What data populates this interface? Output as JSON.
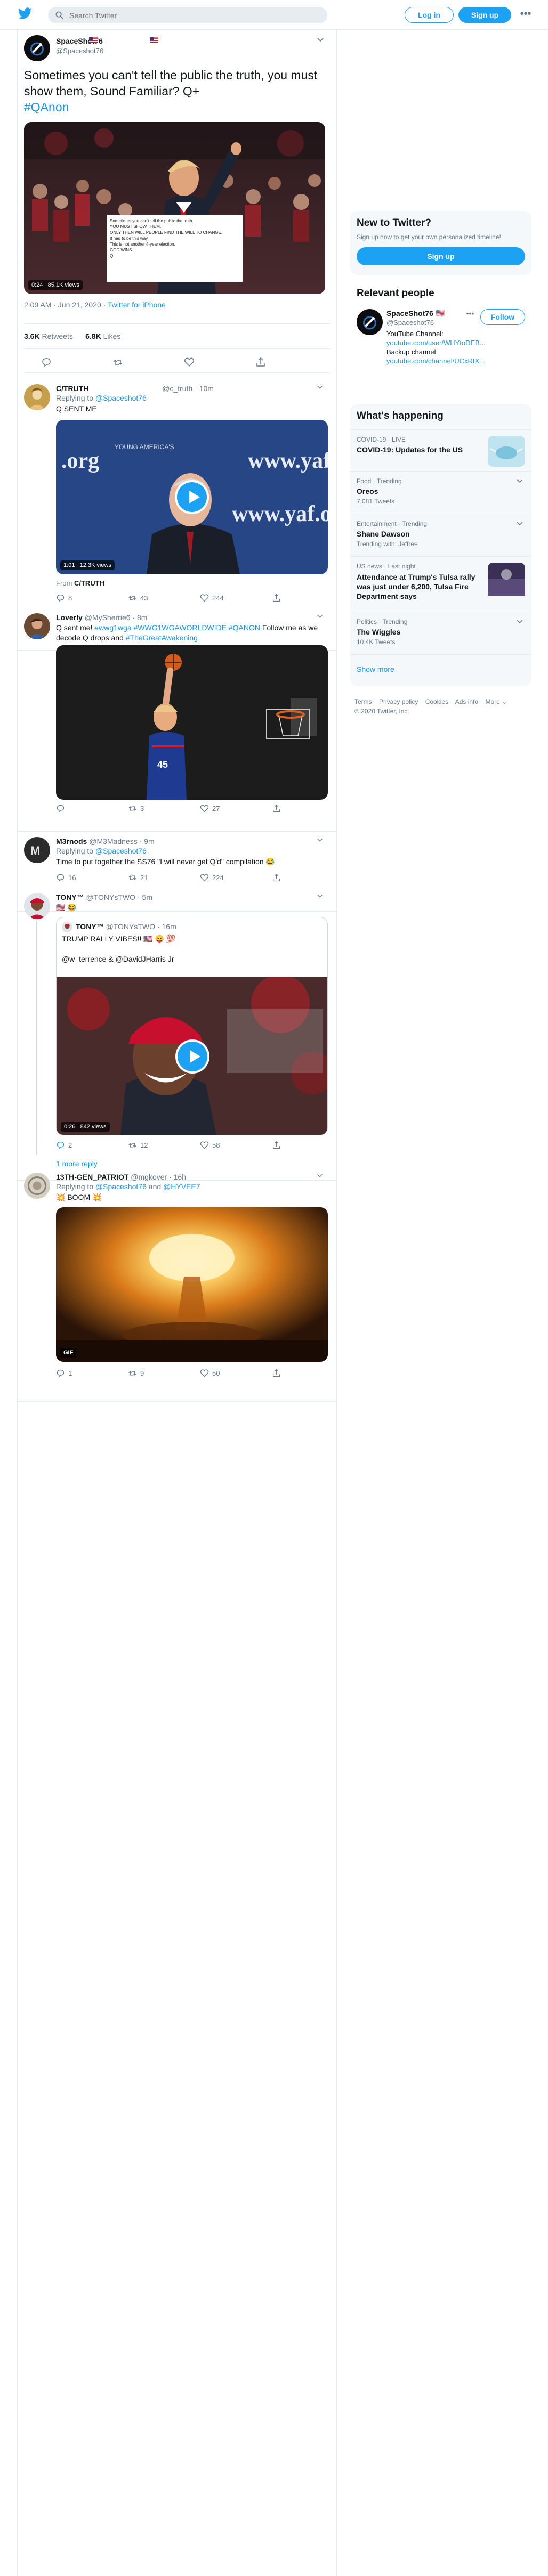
{
  "header": {
    "search_placeholder": "Search Twitter",
    "login_label": "Log in",
    "signup_label": "Sign up",
    "more_icon": "more-dots-icon"
  },
  "focal_tweet": {
    "name": "SpaceShot76",
    "flag": "🇺🇸",
    "handle": "@Spaceshot76",
    "text": "Sometimes you can't tell the public the truth, you must show them, Sound Familiar?  Q+",
    "hashtag": "#QAnon",
    "video_duration": "0:24",
    "video_views": "85.1K views",
    "overlay_lines": [
      "Sometimes you can't tell the public the truth.",
      "YOU MUST SHOW THEM.",
      "ONLY THEN WILL PEOPLE FIND THE WILL TO CHANGE.",
      "It had to be this way.",
      "This is not another 4-year election.",
      "GOD WINS.",
      "Q"
    ],
    "timestamp": "2:09 AM · Jun 21, 2020",
    "source": "Twitter for iPhone",
    "retweets_count": "3.6K",
    "retweets_label": "Retweets",
    "likes_count": "6.8K",
    "likes_label": "Likes"
  },
  "replies": [
    {
      "name": "C/TRUTH",
      "handle": "@c_truth",
      "time": "10m",
      "replying_prefix": "Replying to",
      "replying_to": "@Spaceshot76",
      "text": "Q SENT ME",
      "video_duration": "1:01",
      "video_views": "12.3K views",
      "media_caption": "www.yaf.org",
      "from_prefix": "From",
      "from_name": "C/TRUTH",
      "replies": "8",
      "retweets": "43",
      "likes": "244"
    },
    {
      "name": "Loverly",
      "handle": "@MySherrie6",
      "time": "8m",
      "text_before": "Q sent me!",
      "text_links": "#wwg1wga #WWG1WGAWORLDWIDE #QANON",
      "text_middle": "Follow me as we decode Q drops and",
      "text_link2": "#TheGreatAwakening",
      "retweets": "3",
      "likes": "27"
    },
    {
      "name": "M3rnods",
      "handle": "@M3Madness",
      "time": "9m",
      "replying_prefix": "Replying to",
      "replying_to": "@Spaceshot76",
      "text": "Time to put together the SS76 \"I will never get Q'd\" compilation 😂",
      "replies": "16",
      "retweets": "21",
      "likes": "224"
    },
    {
      "name": "TONY™",
      "handle": "@TONYsTWO",
      "time": "5m",
      "text": "🇺🇸 😂",
      "quote_name": "TONY™",
      "quote_handle": "@TONYsTWO",
      "quote_time": "16m",
      "quote_text": "TRUMP RALLY VIBES!! 🇺🇸 😝 💯",
      "quote_mentions": "@w_terrence & @DavidJHarris Jr",
      "video_duration": "0:26",
      "video_views": "842 views",
      "replies": "2",
      "retweets": "12",
      "likes": "58",
      "more_replies": "1 more reply"
    },
    {
      "name": "13TH-GEN_PATRIOT",
      "handle": "@mgkover",
      "time": "16h",
      "replying_prefix": "Replying to",
      "replying_to": "@Spaceshot76",
      "replying_and": "and",
      "replying_to2": "@HYVEE7",
      "text": "💥 BOOM 💥",
      "gif_badge": "GIF",
      "replies": "1",
      "retweets": "9",
      "likes": "50"
    }
  ],
  "sidebar": {
    "new_title": "New to Twitter?",
    "new_sub": "Sign up now to get your own personalized timeline!",
    "new_button": "Sign up",
    "relevant_title": "Relevant people",
    "person_name": "SpaceShot76",
    "person_flag": "🇺🇸",
    "person_handle": "@Spaceshot76",
    "follow_label": "Follow",
    "bio_line1": "YouTube Channel:",
    "bio_link1": "youtube.com/user/WHYtoDEB...",
    "bio_line2": "Backup channel:",
    "bio_link2": "youtube.com/channel/UCxRIX...",
    "happening_title": "What's happening",
    "trends": [
      {
        "meta": "COVID-19 · LIVE",
        "name": "COVID-19: Updates for the US",
        "sub": ""
      },
      {
        "meta": "Food · Trending",
        "name": "Oreos",
        "sub": "7,081 Tweets"
      },
      {
        "meta": "Entertainment · Trending",
        "name": "Shane Dawson",
        "sub": "Trending with: Jeffree"
      },
      {
        "meta": "US news · Last night",
        "name": "Attendance at Trump's Tulsa rally was just under 6,200, Tulsa Fire Department says",
        "sub": ""
      },
      {
        "meta": "Politics · Trending",
        "name": "The Wiggles",
        "sub": "10.4K Tweets"
      }
    ],
    "show_more": "Show more",
    "footer_links": [
      "Terms",
      "Privacy policy",
      "Cookies",
      "Ads info",
      "More ⌄"
    ],
    "copyright": "© 2020 Twitter, Inc."
  }
}
